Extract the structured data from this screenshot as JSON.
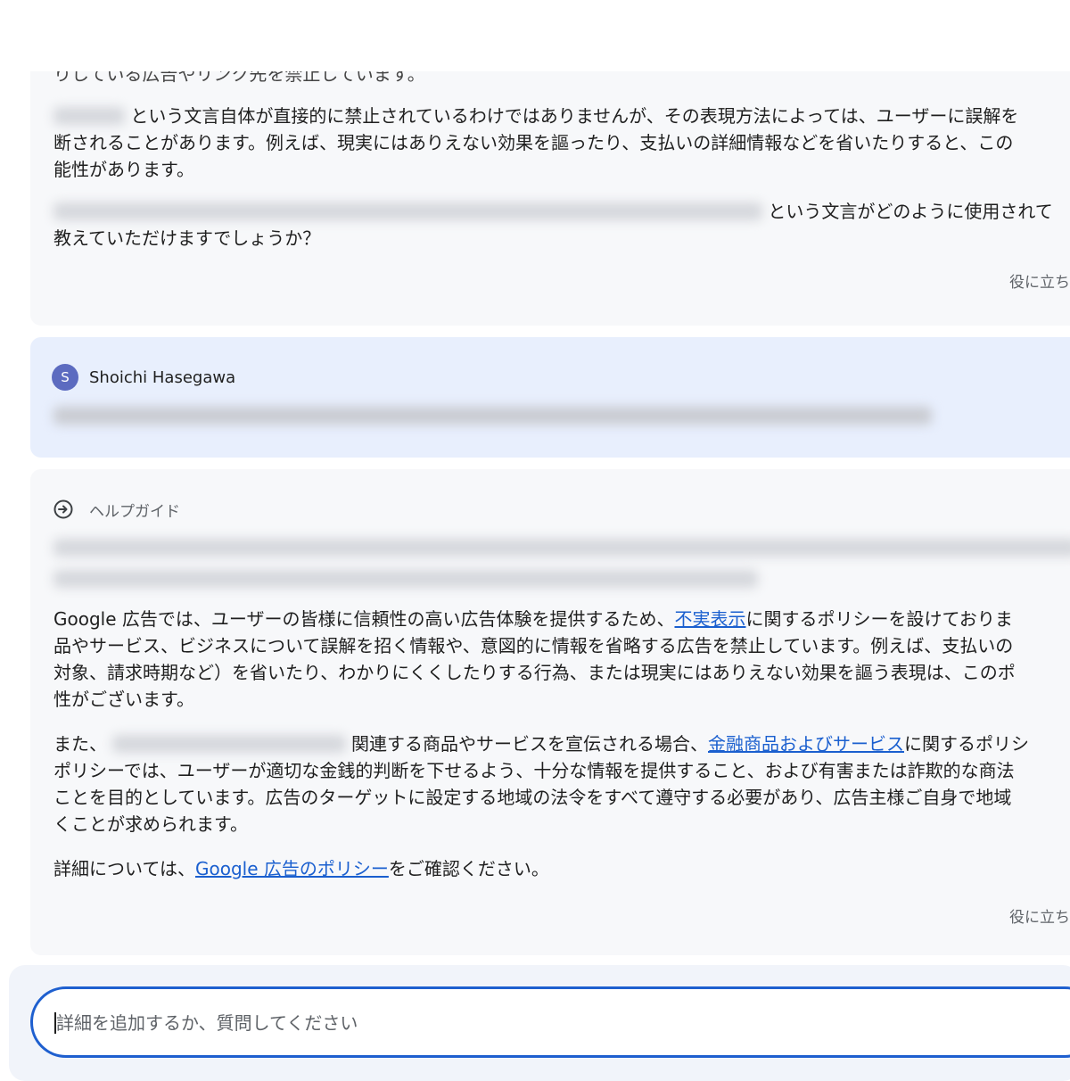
{
  "previous_reply": {
    "cutoff_line": "りしている広告やリンク先を禁止しています。",
    "para1_line1": "という文言自体が直接的に禁止されているわけではありませんが、その表現方法によっては、ユーザーに誤解を",
    "para1_line2": "断されることがあります。例えば、現実にはありえない効果を謳ったり、支払いの詳細情報などを省いたりすると、この",
    "para1_line3": "能性があります。",
    "para2_line1": "という文言がどのように使用されて",
    "para2_line2": "教えていただけますでしょうか？",
    "feedback": "役に立ち"
  },
  "user_message": {
    "avatar_letter": "S",
    "author": "Shoichi Hasegawa"
  },
  "help_guide": {
    "label": "ヘルプガイド",
    "p1_l1_before": "Google 広告では、ユーザーの皆様に信頼性の高い広告体験を提供するため、",
    "p1_link": "不実表示",
    "p1_l1_after": "に関するポリシーを設けておりま",
    "p1_l2": "品やサービス、ビジネスについて誤解を招く情報や、意図的に情報を省略する広告を禁止しています。例えば、支払いの",
    "p1_l3": "対象、請求時期など）を省いたり、わかりにくくしたりする行為、または現実にはありえない効果を謳う表現は、このポ",
    "p1_l4": "性がございます。",
    "p2_l1_prefix": "また、",
    "p2_l1_mid": "関連する商品やサービスを宣伝される場合、",
    "p2_link": "金融商品およびサービス",
    "p2_l1_after": "に関するポリシ",
    "p2_l2": "ポリシーでは、ユーザーが適切な金銭的判断を下せるよう、十分な情報を提供すること、および有害または詐欺的な商法",
    "p2_l3": "ことを目的としています。広告のターゲットに設定する地域の法令をすべて遵守する必要があり、広告主様ご自身で地域",
    "p2_l4": "くことが求められます。",
    "p3_before": "詳細については、",
    "p3_link": "Google 広告のポリシー",
    "p3_after": "をご確認ください。",
    "feedback": "役に立ち"
  },
  "composer": {
    "placeholder": "詳細を追加するか、質問してください"
  },
  "colors": {
    "accent": "#1e5fcf",
    "link": "#1a5fcf",
    "user_bubble": "#e8effd",
    "card_bg": "#f7f8fa",
    "avatar": "#5c6bc0"
  },
  "icons": {
    "guide": "help-guide-icon"
  }
}
